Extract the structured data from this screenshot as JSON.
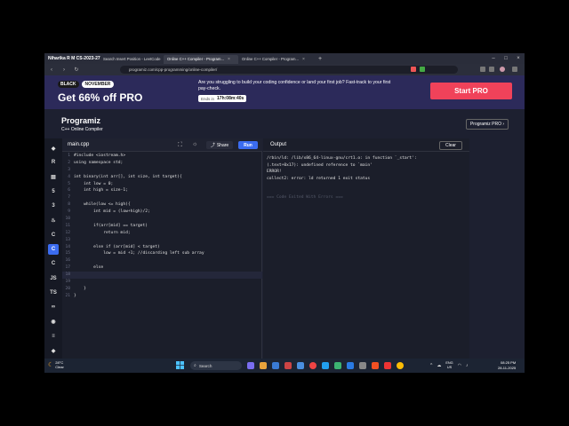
{
  "titlebar": {
    "user": "Niharika R M CS-2023-27",
    "tabs": [
      {
        "label": "Search Insert Position - LeetCode",
        "active": false
      },
      {
        "label": "Online C++ Compiler - Program...",
        "active": true
      },
      {
        "label": "Online C++ Compiler - Program...",
        "active": false
      }
    ]
  },
  "address": {
    "url": "programiz.com/cpp-programming/online-compiler/"
  },
  "promo": {
    "tag1": "BLACK",
    "tag2": "NOVEMBER",
    "headline": "Get 66% off PRO",
    "message": "Are you struggling to build your coding confidence or land your first job? Fast-track to your first pay-check.",
    "ends_label": "Ends in",
    "ends_time": "17h:08m:40s",
    "cta": "Start PRO"
  },
  "site": {
    "logo": "Programiz",
    "subtitle": "C++ Online Compiler",
    "pro_button": "Programiz PRO ›"
  },
  "sidebar": {
    "items": [
      {
        "icon": "python-icon",
        "glyph": "◆",
        "active": false
      },
      {
        "icon": "r-icon",
        "glyph": "R",
        "active": false
      },
      {
        "icon": "sql-icon",
        "glyph": "▤",
        "active": false
      },
      {
        "icon": "html-icon",
        "glyph": "5",
        "active": false
      },
      {
        "icon": "css-icon",
        "glyph": "3",
        "active": false
      },
      {
        "icon": "java-icon",
        "glyph": "♨",
        "active": false
      },
      {
        "icon": "c-icon",
        "glyph": "C",
        "active": false
      },
      {
        "icon": "cpp-icon",
        "glyph": "C",
        "active": true
      },
      {
        "icon": "csharp-icon",
        "glyph": "C",
        "active": false
      },
      {
        "icon": "js-icon",
        "glyph": "JS",
        "active": false
      },
      {
        "icon": "ts-icon",
        "glyph": "TS",
        "active": false
      },
      {
        "icon": "go-icon",
        "glyph": "∞",
        "active": false
      },
      {
        "icon": "php-icon",
        "glyph": "◉",
        "active": false
      },
      {
        "icon": "swift-icon",
        "glyph": "≡",
        "active": false
      },
      {
        "icon": "rust-icon",
        "glyph": "◆",
        "active": false
      }
    ]
  },
  "editor": {
    "file": "main.cpp",
    "share": "Share",
    "run": "Run",
    "lines": [
      {
        "n": "1",
        "code": "#include <iostream.h>"
      },
      {
        "n": "2",
        "code": "using namespace std;"
      },
      {
        "n": "3",
        "code": ""
      },
      {
        "n": "4",
        "code": "int binary(int arr[], int size, int target){"
      },
      {
        "n": "5",
        "code": "    int low = 0;"
      },
      {
        "n": "6",
        "code": "    int high = size-1;"
      },
      {
        "n": "7",
        "code": ""
      },
      {
        "n": "8",
        "code": "    while(low <= high){"
      },
      {
        "n": "9",
        "code": "        int mid = (low+high)/2;"
      },
      {
        "n": "10",
        "code": ""
      },
      {
        "n": "11",
        "code": "        if(arr[mid] == target)"
      },
      {
        "n": "12",
        "code": "            return mid;"
      },
      {
        "n": "13",
        "code": ""
      },
      {
        "n": "14",
        "code": "        else if (arr[mid] < target)"
      },
      {
        "n": "15",
        "code": "            low = mid +1; //discarding left sub array"
      },
      {
        "n": "16",
        "code": ""
      },
      {
        "n": "17",
        "code": "        else"
      },
      {
        "n": "18",
        "code": ""
      },
      {
        "n": "19",
        "code": ""
      },
      {
        "n": "20",
        "code": "    }"
      },
      {
        "n": "21",
        "code": "}"
      }
    ]
  },
  "output": {
    "label": "Output",
    "clear": "Clear",
    "lines": [
      "/rbin/ld: /lib/x86_64-linux-gnu/crt1.o: in function `_start':",
      "(.text+0x17): undefined reference to `main'",
      "ERROR!",
      "collect2: error: ld returned 1 exit status"
    ],
    "footer": "=== Code Exited With Errors ==="
  },
  "taskbar": {
    "temp": "28°C",
    "condition": "Clear",
    "search": "Search",
    "lang1": "ENG",
    "lang2": "US",
    "time": "08:25 PM",
    "date": "28-11-2025"
  }
}
